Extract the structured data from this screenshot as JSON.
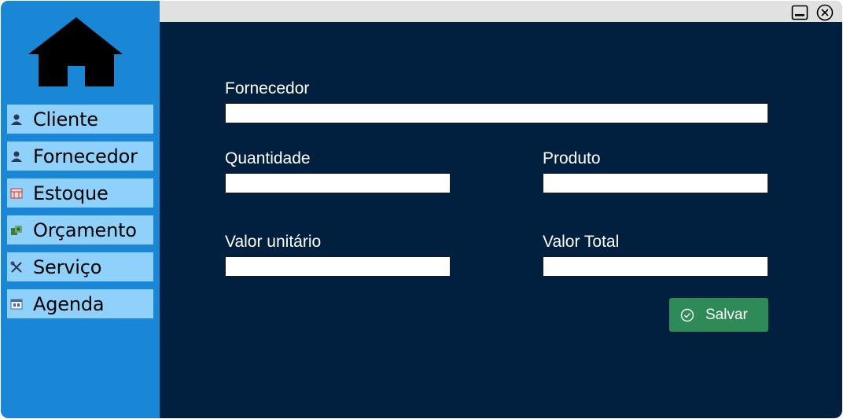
{
  "sidebar": {
    "logo_icon": "home-icon",
    "items": [
      {
        "label": "Cliente",
        "icon": "user-icon"
      },
      {
        "label": "Fornecedor",
        "icon": "supplier-icon"
      },
      {
        "label": "Estoque",
        "icon": "warehouse-icon"
      },
      {
        "label": "Orçamento",
        "icon": "money-icon"
      },
      {
        "label": "Serviço",
        "icon": "tools-icon"
      },
      {
        "label": "Agenda",
        "icon": "calendar-icon"
      }
    ]
  },
  "titlebar": {
    "minimize_icon": "minimize-icon",
    "close_icon": "close-icon"
  },
  "form": {
    "fornecedor": {
      "label": "Fornecedor",
      "value": ""
    },
    "quantidade": {
      "label": "Quantidade",
      "value": ""
    },
    "produto": {
      "label": "Produto",
      "value": ""
    },
    "valor_unitario": {
      "label": "Valor unitário",
      "value": ""
    },
    "valor_total": {
      "label": "Valor Total",
      "value": ""
    },
    "save_label": "Salvar",
    "save_icon": "check-circle-icon"
  },
  "colors": {
    "sidebar": "#1a87d6",
    "menu_item": "#8fd1fb",
    "main_bg": "#012040",
    "save_button": "#2e8b57",
    "titlebar": "#e1e1e1"
  }
}
